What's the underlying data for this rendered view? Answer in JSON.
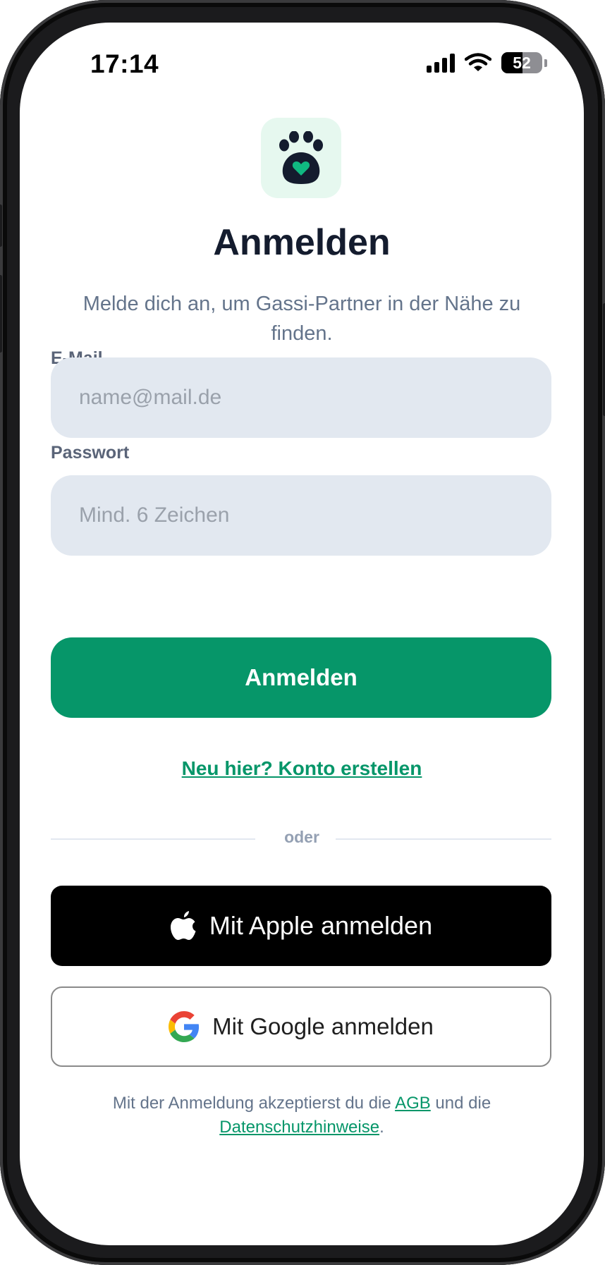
{
  "status_bar": {
    "time": "17:14",
    "battery_level": "52",
    "battery_fraction": 0.52,
    "icons": [
      "signal-icon",
      "wifi-icon",
      "battery-icon"
    ]
  },
  "logo": {
    "icon": "paw-heart-icon",
    "background_color": "#e6f8ef",
    "icon_color": "#141c2e",
    "heart_color": "#10b981"
  },
  "header": {
    "title": "Anmelden",
    "subtitle": "Melde dich an, um Gassi-Partner in der Nähe zu finden."
  },
  "form": {
    "email": {
      "label": "E-Mail",
      "value": "",
      "placeholder": "name@mail.de"
    },
    "password": {
      "label": "Passwort",
      "value": "",
      "placeholder": "Mind. 6 Zeichen"
    },
    "submit_label": "Anmelden"
  },
  "register_link": "Neu hier? Konto erstellen",
  "divider_label": "oder",
  "social": {
    "apple_label": "Mit Apple anmelden",
    "apple_icon": "apple-logo-icon",
    "google_label": "Mit Google anmelden",
    "google_icon": "google-logo-icon"
  },
  "legal": {
    "prefix": "Mit der Anmeldung akzeptierst du die",
    "agb_link": "AGB",
    "middle": "und die",
    "privacy_link": "Datenschutzhinweise",
    "suffix": "."
  },
  "colors": {
    "accent": "#069669",
    "title": "#141c2e",
    "muted": "#64748b",
    "input_background": "#e2e8f0"
  }
}
